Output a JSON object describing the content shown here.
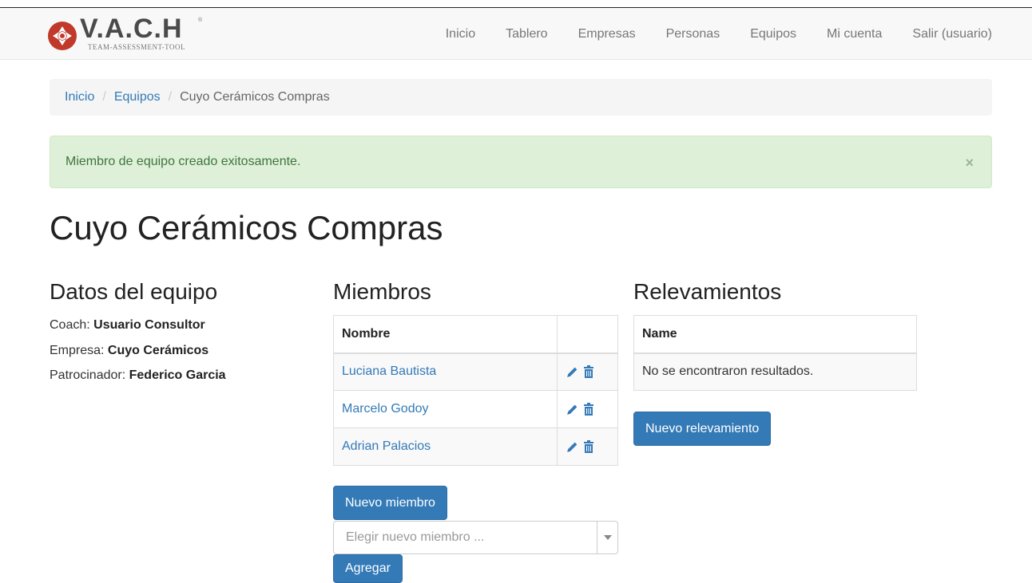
{
  "brand": {
    "name": "V.A.C.H",
    "tagline": "TEAM-ASSESSMENT-TOOL",
    "registered": "®"
  },
  "nav": [
    "Inicio",
    "Tablero",
    "Empresas",
    "Personas",
    "Equipos",
    "Mi cuenta",
    "Salir (usuario)"
  ],
  "breadcrumb": {
    "items": [
      "Inicio",
      "Equipos"
    ],
    "separator": "/",
    "active": "Cuyo Cerámicos Compras"
  },
  "alert": {
    "message": "Miembro de equipo creado exitosamente.",
    "close": "×"
  },
  "page_title": "Cuyo Cerámicos Compras",
  "datos": {
    "heading": "Datos del equipo",
    "coach_label": "Coach:",
    "coach_value": "Usuario Consultor",
    "empresa_label": "Empresa:",
    "empresa_value": "Cuyo Cerámicos",
    "patrocinador_label": "Patrocinador:",
    "patrocinador_value": "Federico Garcia"
  },
  "miembros": {
    "heading": "Miembros",
    "column_header": "Nombre",
    "rows": [
      "Luciana Bautista",
      "Marcelo Godoy",
      "Adrian Palacios"
    ],
    "new_button": "Nuevo miembro",
    "select_placeholder": "Elegir nuevo miembro ...",
    "add_button": "Agregar"
  },
  "relevamientos": {
    "heading": "Relevamientos",
    "column_header": "Name",
    "empty_text": "No se encontraron resultados.",
    "new_button": "Nuevo relevamiento"
  },
  "colors": {
    "primary": "#337ab7",
    "success_bg": "#dff0d8",
    "success_text": "#3c763d",
    "brand_red": "#c0392b"
  },
  "icons": [
    "edit-icon",
    "trash-icon",
    "chevron-down-icon",
    "vach-logo"
  ]
}
